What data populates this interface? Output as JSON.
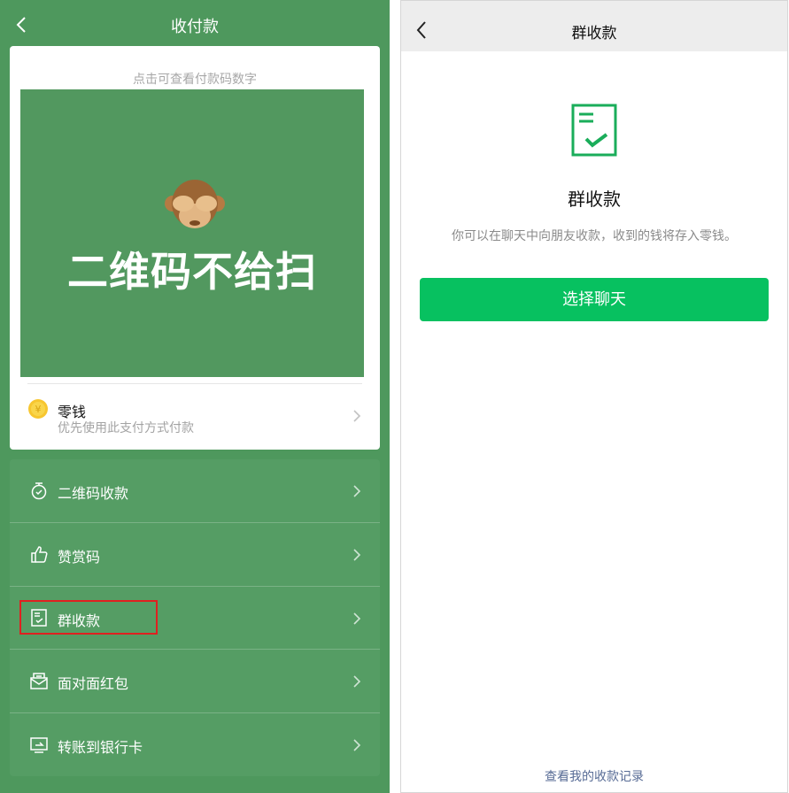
{
  "left": {
    "title": "收付款",
    "hint": "点击可查看付款码数字",
    "qr_overlay_text": "二维码不给扫",
    "wallet": {
      "title": "零钱",
      "subtitle": "优先使用此支付方式付款"
    },
    "menu": [
      {
        "label": "二维码收款",
        "icon": "stopwatch-icon"
      },
      {
        "label": "赞赏码",
        "icon": "thumbs-up-icon"
      },
      {
        "label": "群收款",
        "icon": "group-receipt-icon"
      },
      {
        "label": "面对面红包",
        "icon": "red-packet-icon"
      },
      {
        "label": "转账到银行卡",
        "icon": "bank-card-icon"
      }
    ]
  },
  "right": {
    "title": "群收款",
    "heading": "群收款",
    "description": "你可以在聊天中向朋友收款，收到的钱将存入零钱。",
    "button": "选择聊天",
    "records_link": "查看我的收款记录"
  },
  "colors": {
    "left_bg": "#4e985d",
    "primary_green": "#07c160",
    "link_blue": "#576b95",
    "highlight_red": "#e02020"
  }
}
